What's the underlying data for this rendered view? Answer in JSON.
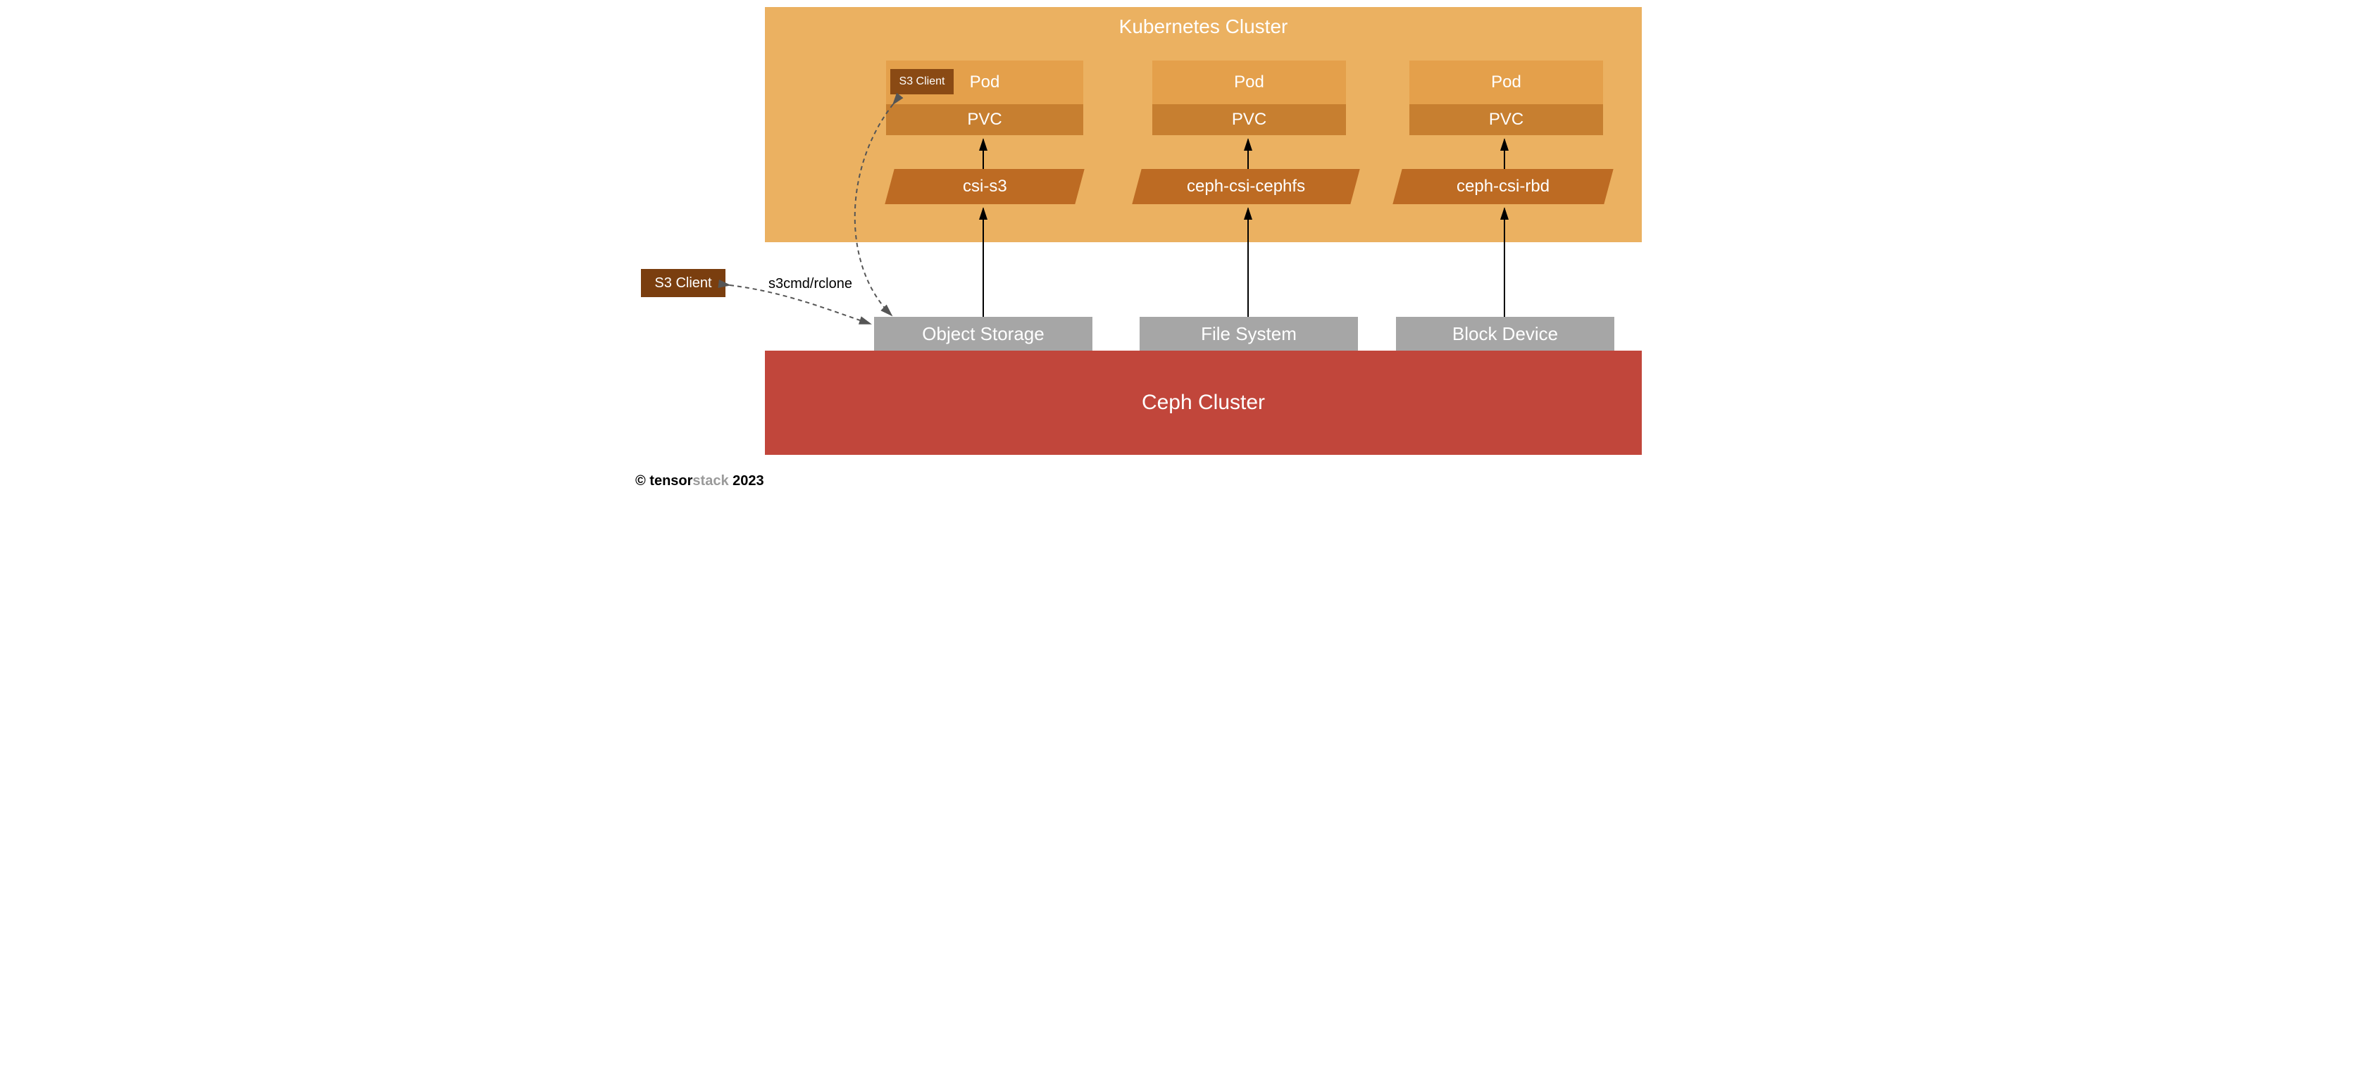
{
  "k8s": {
    "title": "Kubernetes Cluster",
    "columns": [
      {
        "pod": "Pod",
        "pvc": "PVC",
        "csi": "csi-s3",
        "s3_badge": "S3 Client"
      },
      {
        "pod": "Pod",
        "pvc": "PVC",
        "csi": "ceph-csi-cephfs"
      },
      {
        "pod": "Pod",
        "pvc": "PVC",
        "csi": "ceph-csi-rbd"
      }
    ]
  },
  "ceph": {
    "title": "Ceph Cluster",
    "types": [
      "Object Storage",
      "File System",
      "Block Device"
    ]
  },
  "external": {
    "s3_client": "S3 Client",
    "edge_label": "s3cmd/rclone"
  },
  "footer": {
    "prefix": "© tensor",
    "gray": "stack",
    "suffix": " 2023"
  },
  "colors": {
    "k8s_bg": "#ebb161",
    "pod_bg": "#e4a04b",
    "pvc_bg": "#c77f30",
    "csi_bg": "#bd6b23",
    "s3_badge_bg": "#8a4a14",
    "storage_bg": "#a6a6a6",
    "ceph_bg": "#c1463b",
    "s3_client_ext_bg": "#7a3e0f"
  }
}
